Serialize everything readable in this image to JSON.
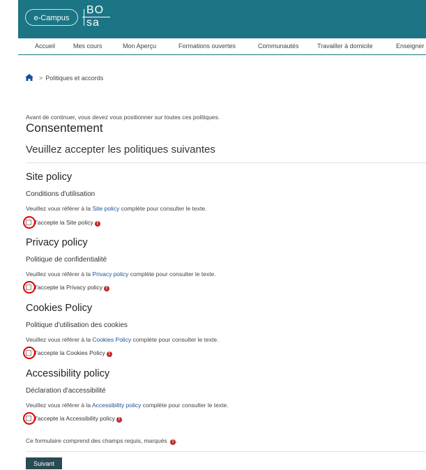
{
  "header": {
    "logo_text": "e-Campus",
    "bosa_top": "BO",
    "bosa_bottom": "SA",
    "brand_color": "#1b7585"
  },
  "nav": {
    "items": [
      "Accueil",
      "Mes cours",
      "Mon Aperçu",
      "Formations ouvertes",
      "Communautés",
      "Travailler à domicile",
      "Enseigner"
    ]
  },
  "breadcrumb": {
    "current": "Politiques et accords",
    "separator": ">"
  },
  "intro": "Avant de continuer, vous devez vous positionner sur toutes ces politiques.",
  "title": "Consentement",
  "subtitle": "Veuillez accepter les politiques suivantes",
  "refer_prefix": "Veuillez vous référer à la",
  "refer_suffix": "complète pour consulter le texte.",
  "accept_prefix": "J'accepte la",
  "policies": [
    {
      "name": "Site policy",
      "summary": "Conditions d'utilisation",
      "link": "Site policy",
      "accept": "Site policy"
    },
    {
      "name": "Privacy policy",
      "summary": "Politique de confidentialité",
      "link": "Privacy policy",
      "accept": "Privacy policy"
    },
    {
      "name": "Cookies Policy",
      "summary": "Politique d'utilisation des cookies",
      "link": "Cookies Policy",
      "accept": "Cookies Policy"
    },
    {
      "name": "Accessibility policy",
      "summary": "Déclaration d'accessibilité",
      "link": "Accessibility policy",
      "accept": "Accessibility policy"
    }
  ],
  "required_note": "Ce formulaire comprend des champs requis, marqués",
  "required_note_end": ".",
  "required_icon": "!",
  "submit_label": "Suivant"
}
